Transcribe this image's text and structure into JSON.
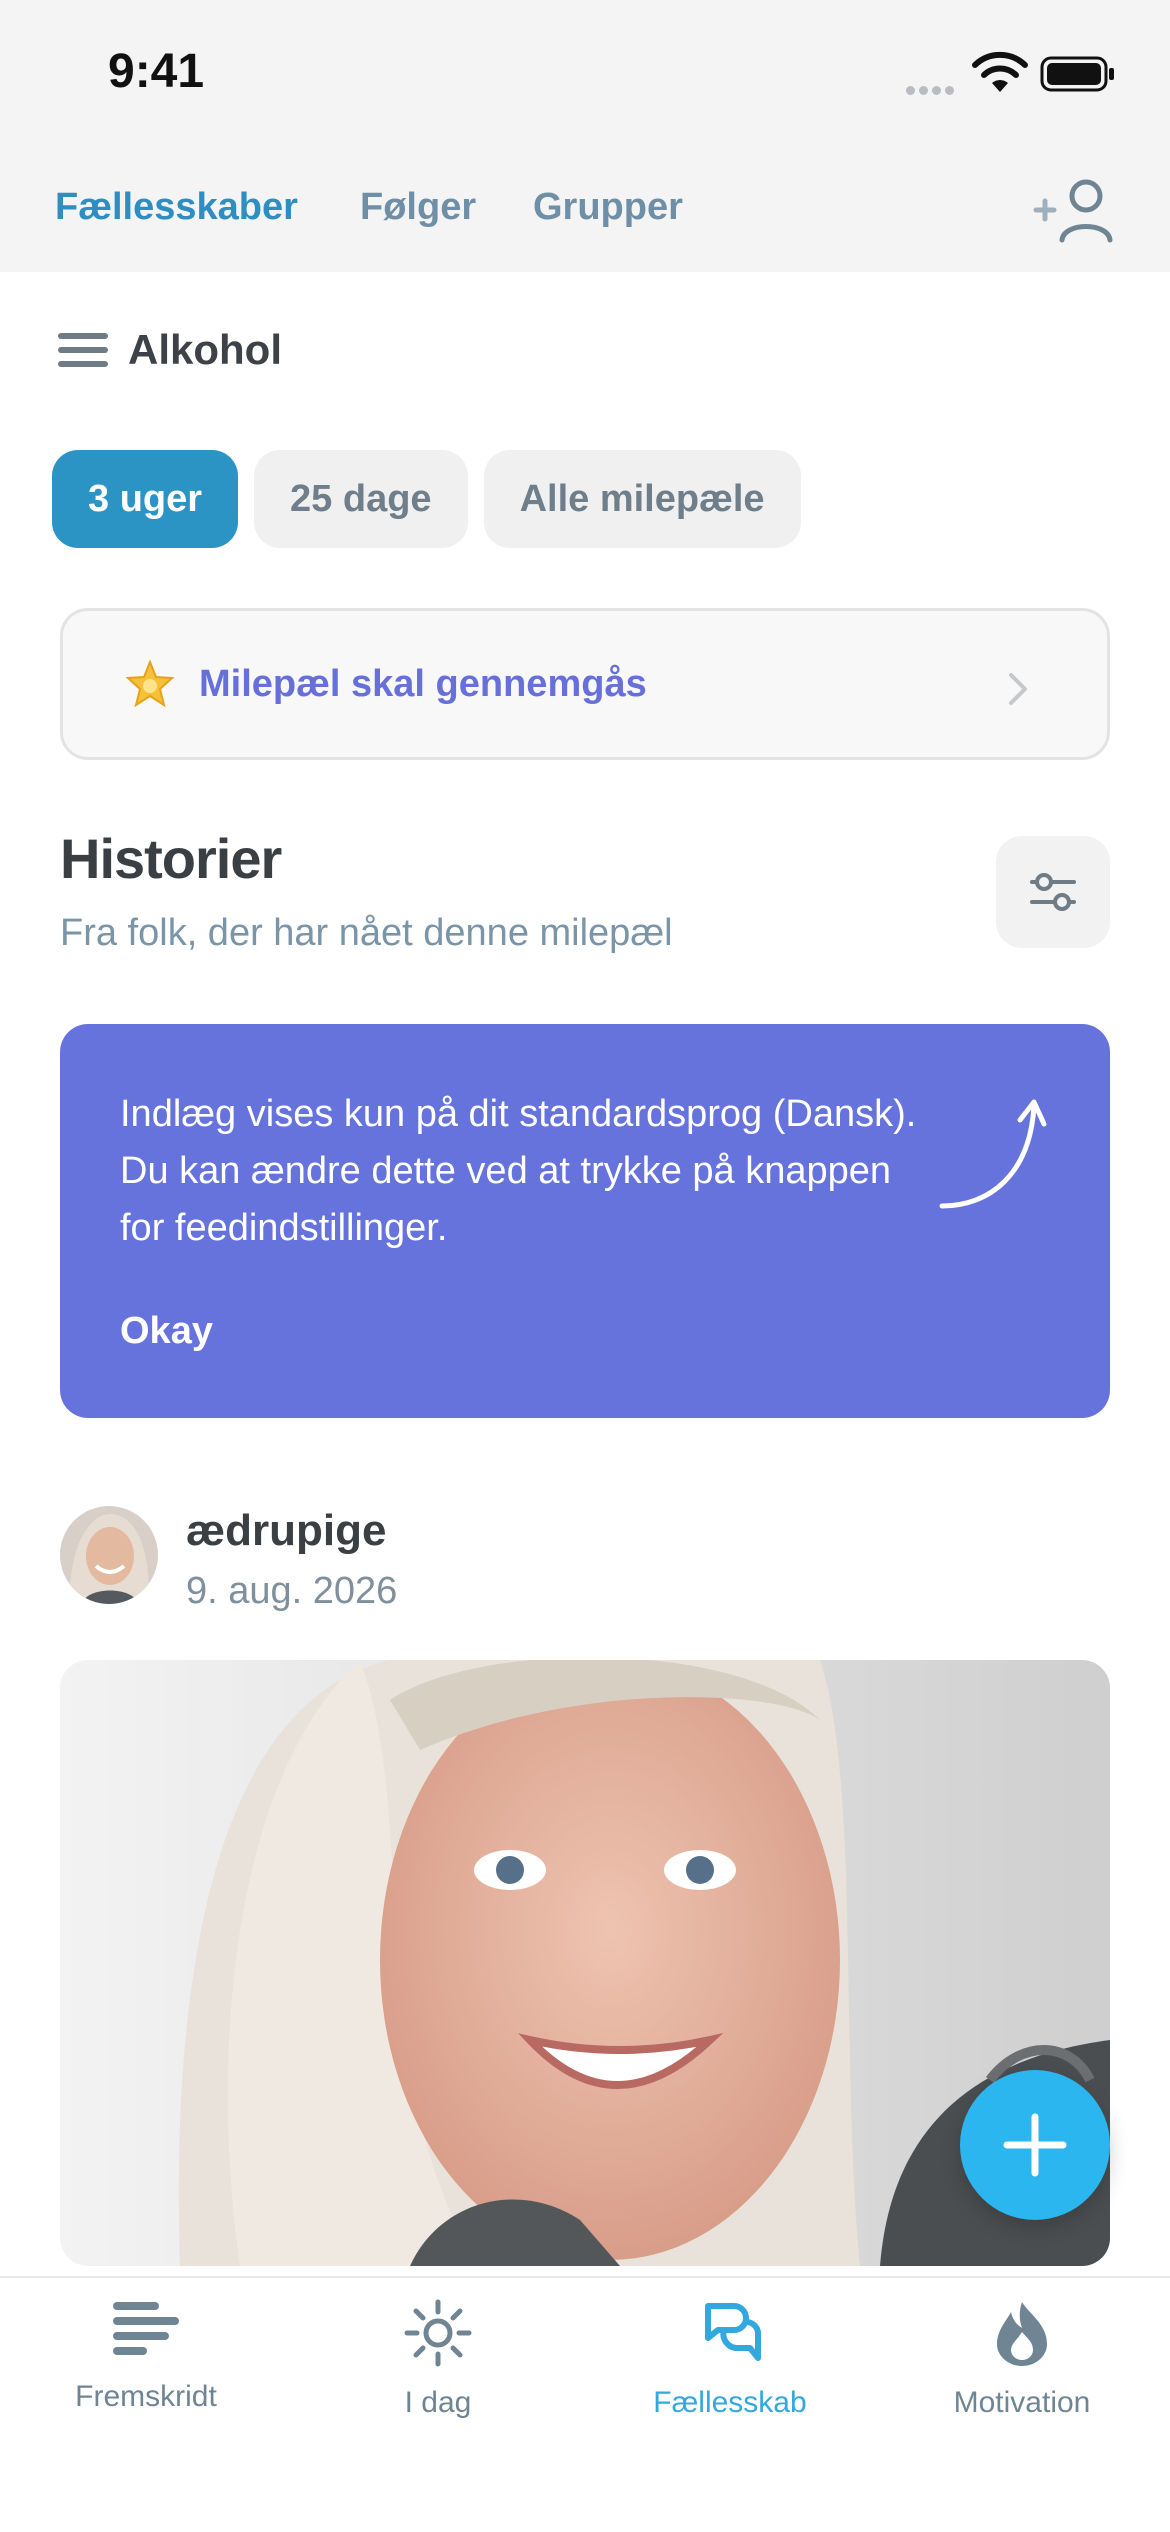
{
  "status_bar": {
    "time": "9:41"
  },
  "top_nav": {
    "tabs": [
      "Fællesskaber",
      "Følger",
      "Grupper"
    ],
    "active_tab": "Fællesskaber",
    "add_user_icon": "add-user-icon"
  },
  "category": {
    "label": "Alkohol",
    "menu_icon": "menu-icon"
  },
  "filters": {
    "chips": [
      "3 uger",
      "25 dage",
      "Alle milepæle"
    ],
    "active_chip": "3 uger"
  },
  "milestone_card": {
    "icon": "star-icon",
    "text": "Milepæl skal gennemgås"
  },
  "stories": {
    "title": "Historier",
    "subtitle": "Fra folk, der har nået denne milepæl",
    "settings_icon": "sliders-icon"
  },
  "banner": {
    "message": "Indlæg vises kun på dit standardsprog (Dansk). Du kan ændre dette ved at trykke på knappen for feedindstillinger.",
    "button": "Okay",
    "color": "#6773dd"
  },
  "post": {
    "author": "ædrupige",
    "date": "9. aug. 2026"
  },
  "fab": {
    "icon": "plus-icon",
    "color": "#2bb6f0"
  },
  "tab_bar": {
    "items": [
      {
        "label": "Fremskridt",
        "icon": "progress-icon"
      },
      {
        "label": "I dag",
        "icon": "sun-icon"
      },
      {
        "label": "Fællesskab",
        "icon": "community-icon"
      },
      {
        "label": "Motivation",
        "icon": "motivation-icon"
      }
    ],
    "active": "Fællesskab"
  },
  "colors": {
    "accent": "#2e8ec2",
    "milestone_text": "#6770d8",
    "tab_active": "#33a8de"
  }
}
